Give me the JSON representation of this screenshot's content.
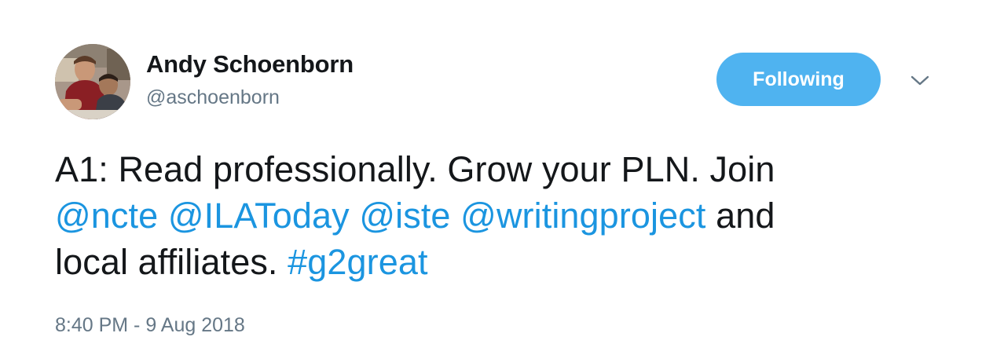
{
  "author": {
    "name": "Andy Schoenborn",
    "handle": "@aschoenborn",
    "avatar_icon": "profile-photo"
  },
  "follow_button": {
    "label": "Following",
    "color": "#4fb3f0"
  },
  "menu": {
    "icon": "chevron-down-icon"
  },
  "tweet": {
    "line1": "A1: Read professionally. Grow your PLN. Join",
    "mentions": [
      "@ncte",
      "@ILAToday",
      "@iste",
      "@writingproject"
    ],
    "line2_tail": "and",
    "line3_text": "local affiliates.",
    "hashtag": "#g2great"
  },
  "timestamp": "8:40 PM - 9 Aug 2018",
  "colors": {
    "link": "#1b95e0",
    "text": "#14171a",
    "muted": "#657786"
  }
}
